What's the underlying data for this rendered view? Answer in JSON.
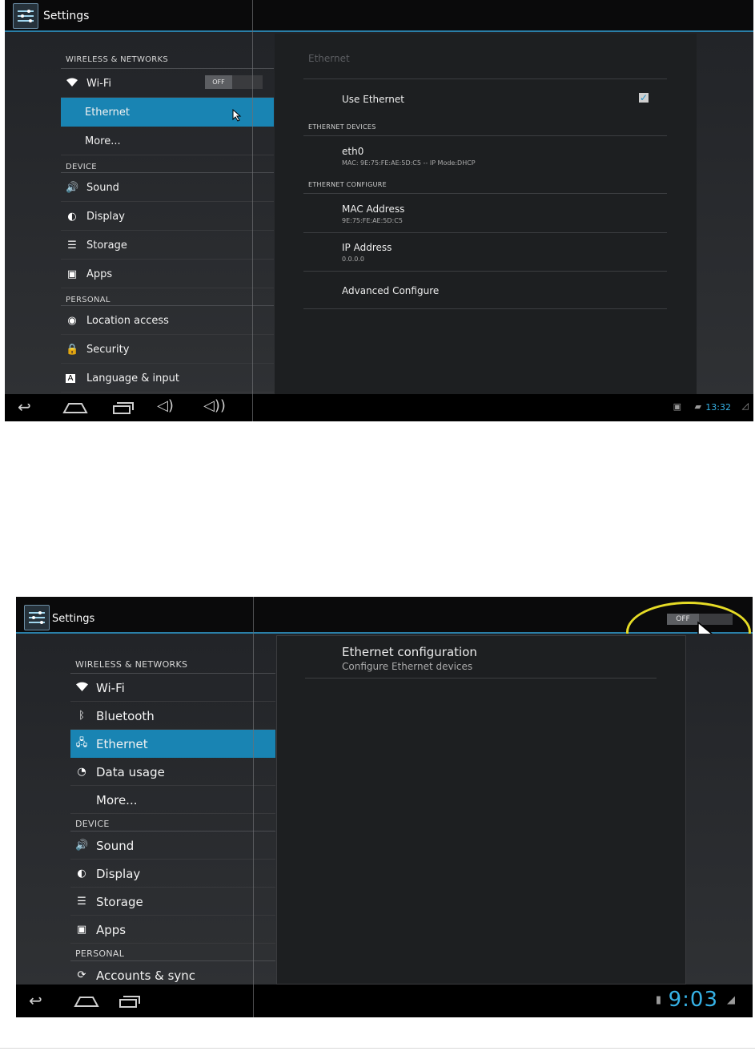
{
  "top": {
    "app_title": "Settings",
    "sidebar": {
      "section_wireless": "WIRELESS & NETWORKS",
      "wifi": {
        "label": "Wi-Fi",
        "toggle": "OFF"
      },
      "ethernet": "Ethernet",
      "more": "More...",
      "section_device": "DEVICE",
      "sound": "Sound",
      "display": "Display",
      "storage": "Storage",
      "apps": "Apps",
      "section_personal": "PERSONAL",
      "location": "Location access",
      "security": "Security",
      "language": "Language & input"
    },
    "detail": {
      "title": "Ethernet",
      "use_ethernet": "Use Ethernet",
      "use_ethernet_checked": true,
      "section_devices": "ETHERNET DEVICES",
      "eth0_title": "eth0",
      "eth0_sub": "MAC: 9E:75:FE:AE:5D:C5 -- IP Mode:DHCP",
      "section_configure": "ETHERNET CONFIGURE",
      "mac_title": "MAC Address",
      "mac_value": "9E:75:FE:AE:5D:C5",
      "ip_title": "IP Address",
      "ip_value": "0.0.0.0",
      "advanced": "Advanced Configure"
    },
    "status": {
      "clock": "13:32"
    }
  },
  "bottom": {
    "app_title": "Settings",
    "master_toggle": "OFF",
    "sidebar": {
      "section_wireless": "WIRELESS & NETWORKS",
      "wifi": "Wi-Fi",
      "bluetooth": "Bluetooth",
      "ethernet": "Ethernet",
      "data_usage": "Data usage",
      "more": "More...",
      "section_device": "DEVICE",
      "sound": "Sound",
      "display": "Display",
      "storage": "Storage",
      "apps": "Apps",
      "section_personal": "PERSONAL",
      "accounts": "Accounts & sync"
    },
    "detail": {
      "config_title": "Ethernet configuration",
      "config_sub": "Configure Ethernet devices"
    },
    "status": {
      "clock": "9:03"
    }
  },
  "colors": {
    "accent": "#1984b3",
    "clock": "#36b2e6",
    "highlight_ring": "#e6dc26"
  }
}
